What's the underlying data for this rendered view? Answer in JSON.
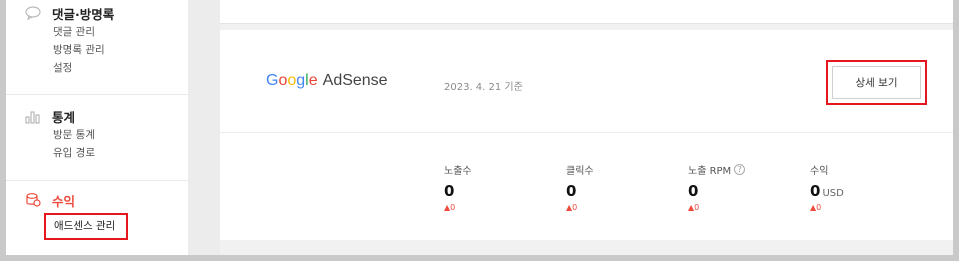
{
  "sidebar": {
    "comments_section": {
      "icon": "speech-bubble-icon",
      "title": "댓글·방명록",
      "items": [
        "댓글 관리",
        "방명록 관리",
        "설정"
      ]
    },
    "stats_section": {
      "icon": "bar-chart-icon",
      "title": "통계",
      "items": [
        "방문 통계",
        "유입 경로"
      ]
    },
    "revenue_section": {
      "icon": "coins-icon",
      "title": "수익",
      "active_item": "애드센스 관리"
    }
  },
  "adsense": {
    "brand": {
      "letters": [
        "G",
        "o",
        "o",
        "g",
        "l",
        "e"
      ],
      "product": "AdSense"
    },
    "as_of": "2023. 4. 21 기준",
    "detail_button": "상세 보기"
  },
  "stats": [
    {
      "label": "노출수",
      "value": "0",
      "unit": "",
      "delta": "▲0",
      "help": false
    },
    {
      "label": "클릭수",
      "value": "0",
      "unit": "",
      "delta": "▲0",
      "help": false
    },
    {
      "label": "노출 RPM",
      "value": "0",
      "unit": "",
      "delta": "▲0",
      "help": true
    },
    {
      "label": "수익",
      "value": "0",
      "unit": "USD",
      "delta": "▲0",
      "help": false
    }
  ],
  "colors": {
    "accent_red": "#ee4b3c",
    "highlight_box": "#e4161e"
  }
}
